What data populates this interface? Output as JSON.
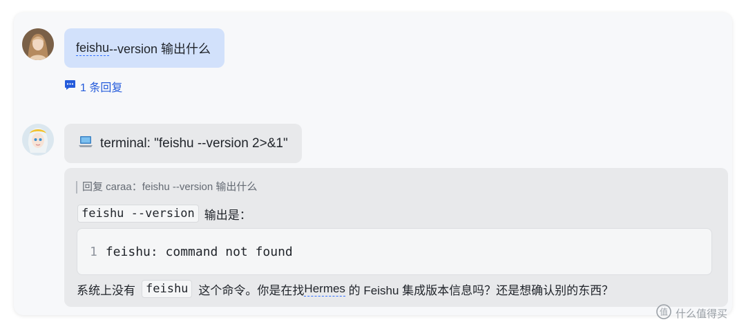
{
  "thread": {
    "user_message": {
      "word_underlined": "feishu",
      "rest": " --version 输出什么"
    },
    "reply_count": {
      "icon": "comment-icon",
      "label": "1 条回复"
    }
  },
  "bot": {
    "terminal_call": {
      "icon": "laptop-icon",
      "label": "terminal: \"feishu --version 2>&1\""
    },
    "reply": {
      "quote_prefix": "回复 caraa：",
      "quote_text": "feishu --version 输出什么",
      "answer_code": "feishu --version",
      "answer_suffix": "输出是：",
      "code_block": {
        "line_number": "1",
        "code": "feishu: command not found"
      },
      "final": {
        "prefix": "系统上没有",
        "code": "feishu",
        "mid": "这个命令。你是在找 ",
        "link": "Hermes",
        "suffix": " 的 Feishu 集成版本信息吗？还是想确认别的东西？"
      }
    }
  },
  "watermark": {
    "text": "什么值得买",
    "icon": "smzdm-logo-icon"
  }
}
